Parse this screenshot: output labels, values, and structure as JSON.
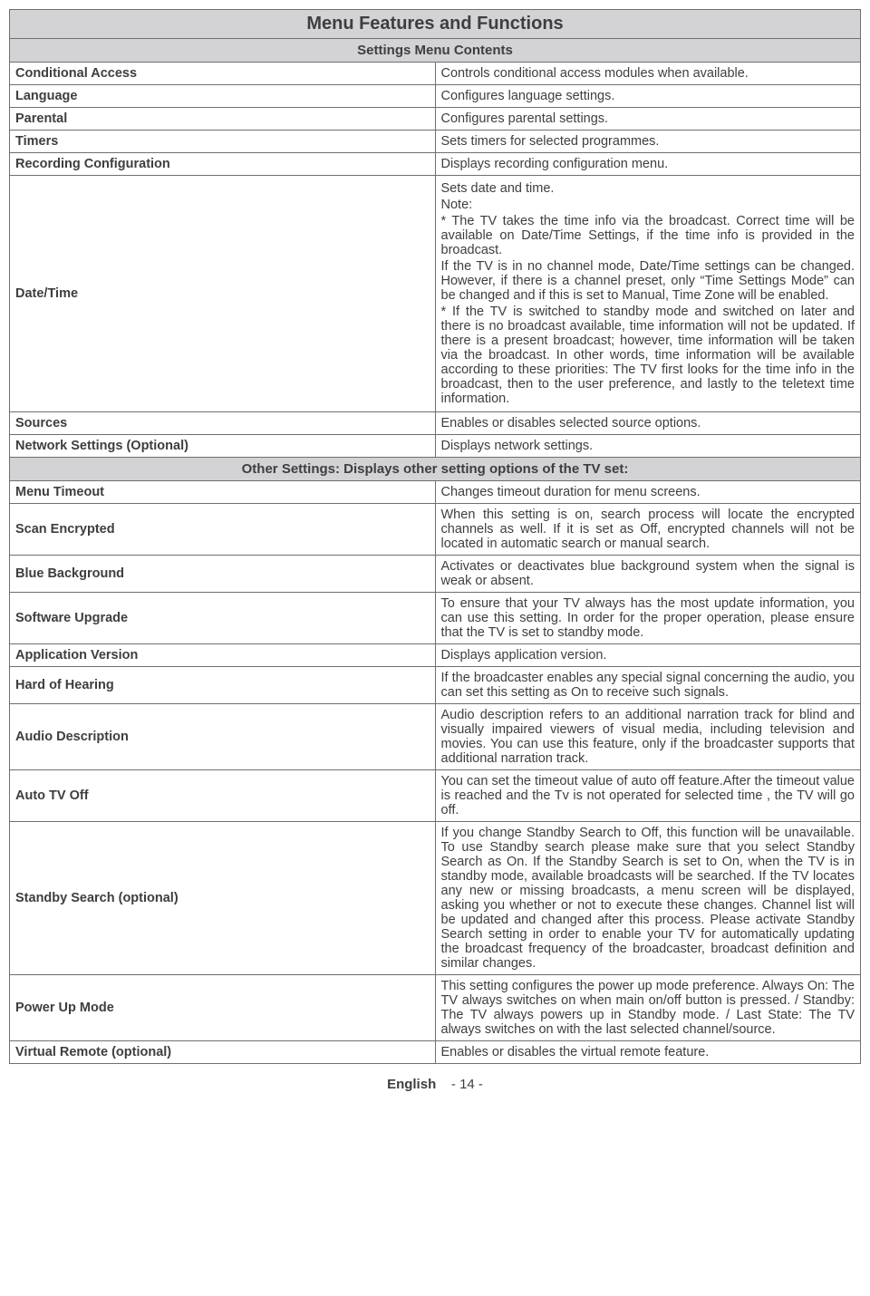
{
  "title": "Menu Features and Functions",
  "section1": "Settings Menu Contents",
  "rows1": [
    {
      "label": "Conditional Access",
      "desc": "Controls conditional access modules when available."
    },
    {
      "label": "Language",
      "desc": "Configures language settings."
    },
    {
      "label": "Parental",
      "desc": "Configures parental settings."
    },
    {
      "label": "Timers",
      "desc": "Sets timers for selected programmes."
    },
    {
      "label": "Recording Configuration",
      "desc": "Displays recording configuration menu."
    }
  ],
  "datetime": {
    "label": "Date/Time",
    "p1": "Sets date and time.",
    "p2": "Note:",
    "p3": "* The TV takes the time info via the broadcast. Correct time will be available on Date/Time Settings, if the time info is provided in the broadcast.",
    "p4": "If the TV is in no channel mode, Date/Time settings can be changed. However,  if there is a channel preset, only “Time Settings Mode” can be changed and if this is set to Manual, Time Zone will be enabled.",
    "p5": "* If the TV is switched to standby mode and switched on later and there is no broadcast available, time information will not be updated. If there is a present broadcast; however, time information will be taken via the broadcast. In other words, time information will be available according to these priorities: The TV first looks for the time info in the broadcast, then to the user preference, and lastly to the teletext time information."
  },
  "sources": {
    "label": "Sources",
    "desc": "Enables or disables selected source options."
  },
  "network": {
    "label": "Network Settings (Optional)",
    "desc": "Displays network settings."
  },
  "section2": "Other Settings: Displays other setting options of the TV set:",
  "rows2": [
    {
      "label": "Menu Timeout",
      "desc": "Changes timeout duration for menu screens."
    },
    {
      "label": "Scan Encrypted",
      "desc": "When this setting is on, search process will locate the encrypted channels as well. If it is set as Off, encrypted channels will not be located in automatic search or manual search."
    },
    {
      "label": "Blue Background",
      "desc": "Activates or deactivates blue background system when the signal is weak or absent."
    },
    {
      "label": "Software Upgrade",
      "desc": "To ensure that your TV always has the most update information, you can use this setting. In order for the proper operation, please ensure that the TV is set to standby mode."
    },
    {
      "label": "Application Version",
      "desc": "Displays application version."
    },
    {
      "label": "Hard of Hearing",
      "desc": "If the broadcaster enables any special signal concerning the audio, you can set this setting as On to receive such signals."
    },
    {
      "label": "Audio Description",
      "desc": "Audio description refers to an additional narration track for blind and visually impaired viewers of visual media, including television and movies. You can use this feature, only if the broadcaster supports that additional narration track."
    },
    {
      "label": "Auto TV Off",
      "desc": "You can set the timeout value of auto off feature.After the timeout value is reached and the Tv is not operated for selected time , the TV will go off."
    },
    {
      "label": "Standby Search (optional)",
      "desc": "If you change Standby Search to Off, this function will be unavailable. To use Standby search please make sure that you select Standby Search as On. If the Standby Search is set to On, when the TV is in standby mode, available broadcasts will be searched. If the TV locates any new or missing broadcasts, a menu screen will be displayed, asking you whether or not to execute these changes. Channel list will be updated and changed after this process. Please activate Standby Search setting in order to enable your TV for automatically updating the broadcast frequency of the broadcaster, broadcast definition and similar changes."
    },
    {
      "label": "Power Up Mode",
      "desc": "This setting configures the power up mode preference. Always On: The TV always switches on when main on/off button is pressed. / Standby: The TV always powers up in Standby mode. / Last State: The TV always switches on with the last selected channel/source."
    },
    {
      "label": "Virtual Remote (optional)",
      "desc": "Enables or disables the virtual remote feature."
    }
  ],
  "footer": {
    "lang": "English",
    "page": "- 14 -"
  }
}
